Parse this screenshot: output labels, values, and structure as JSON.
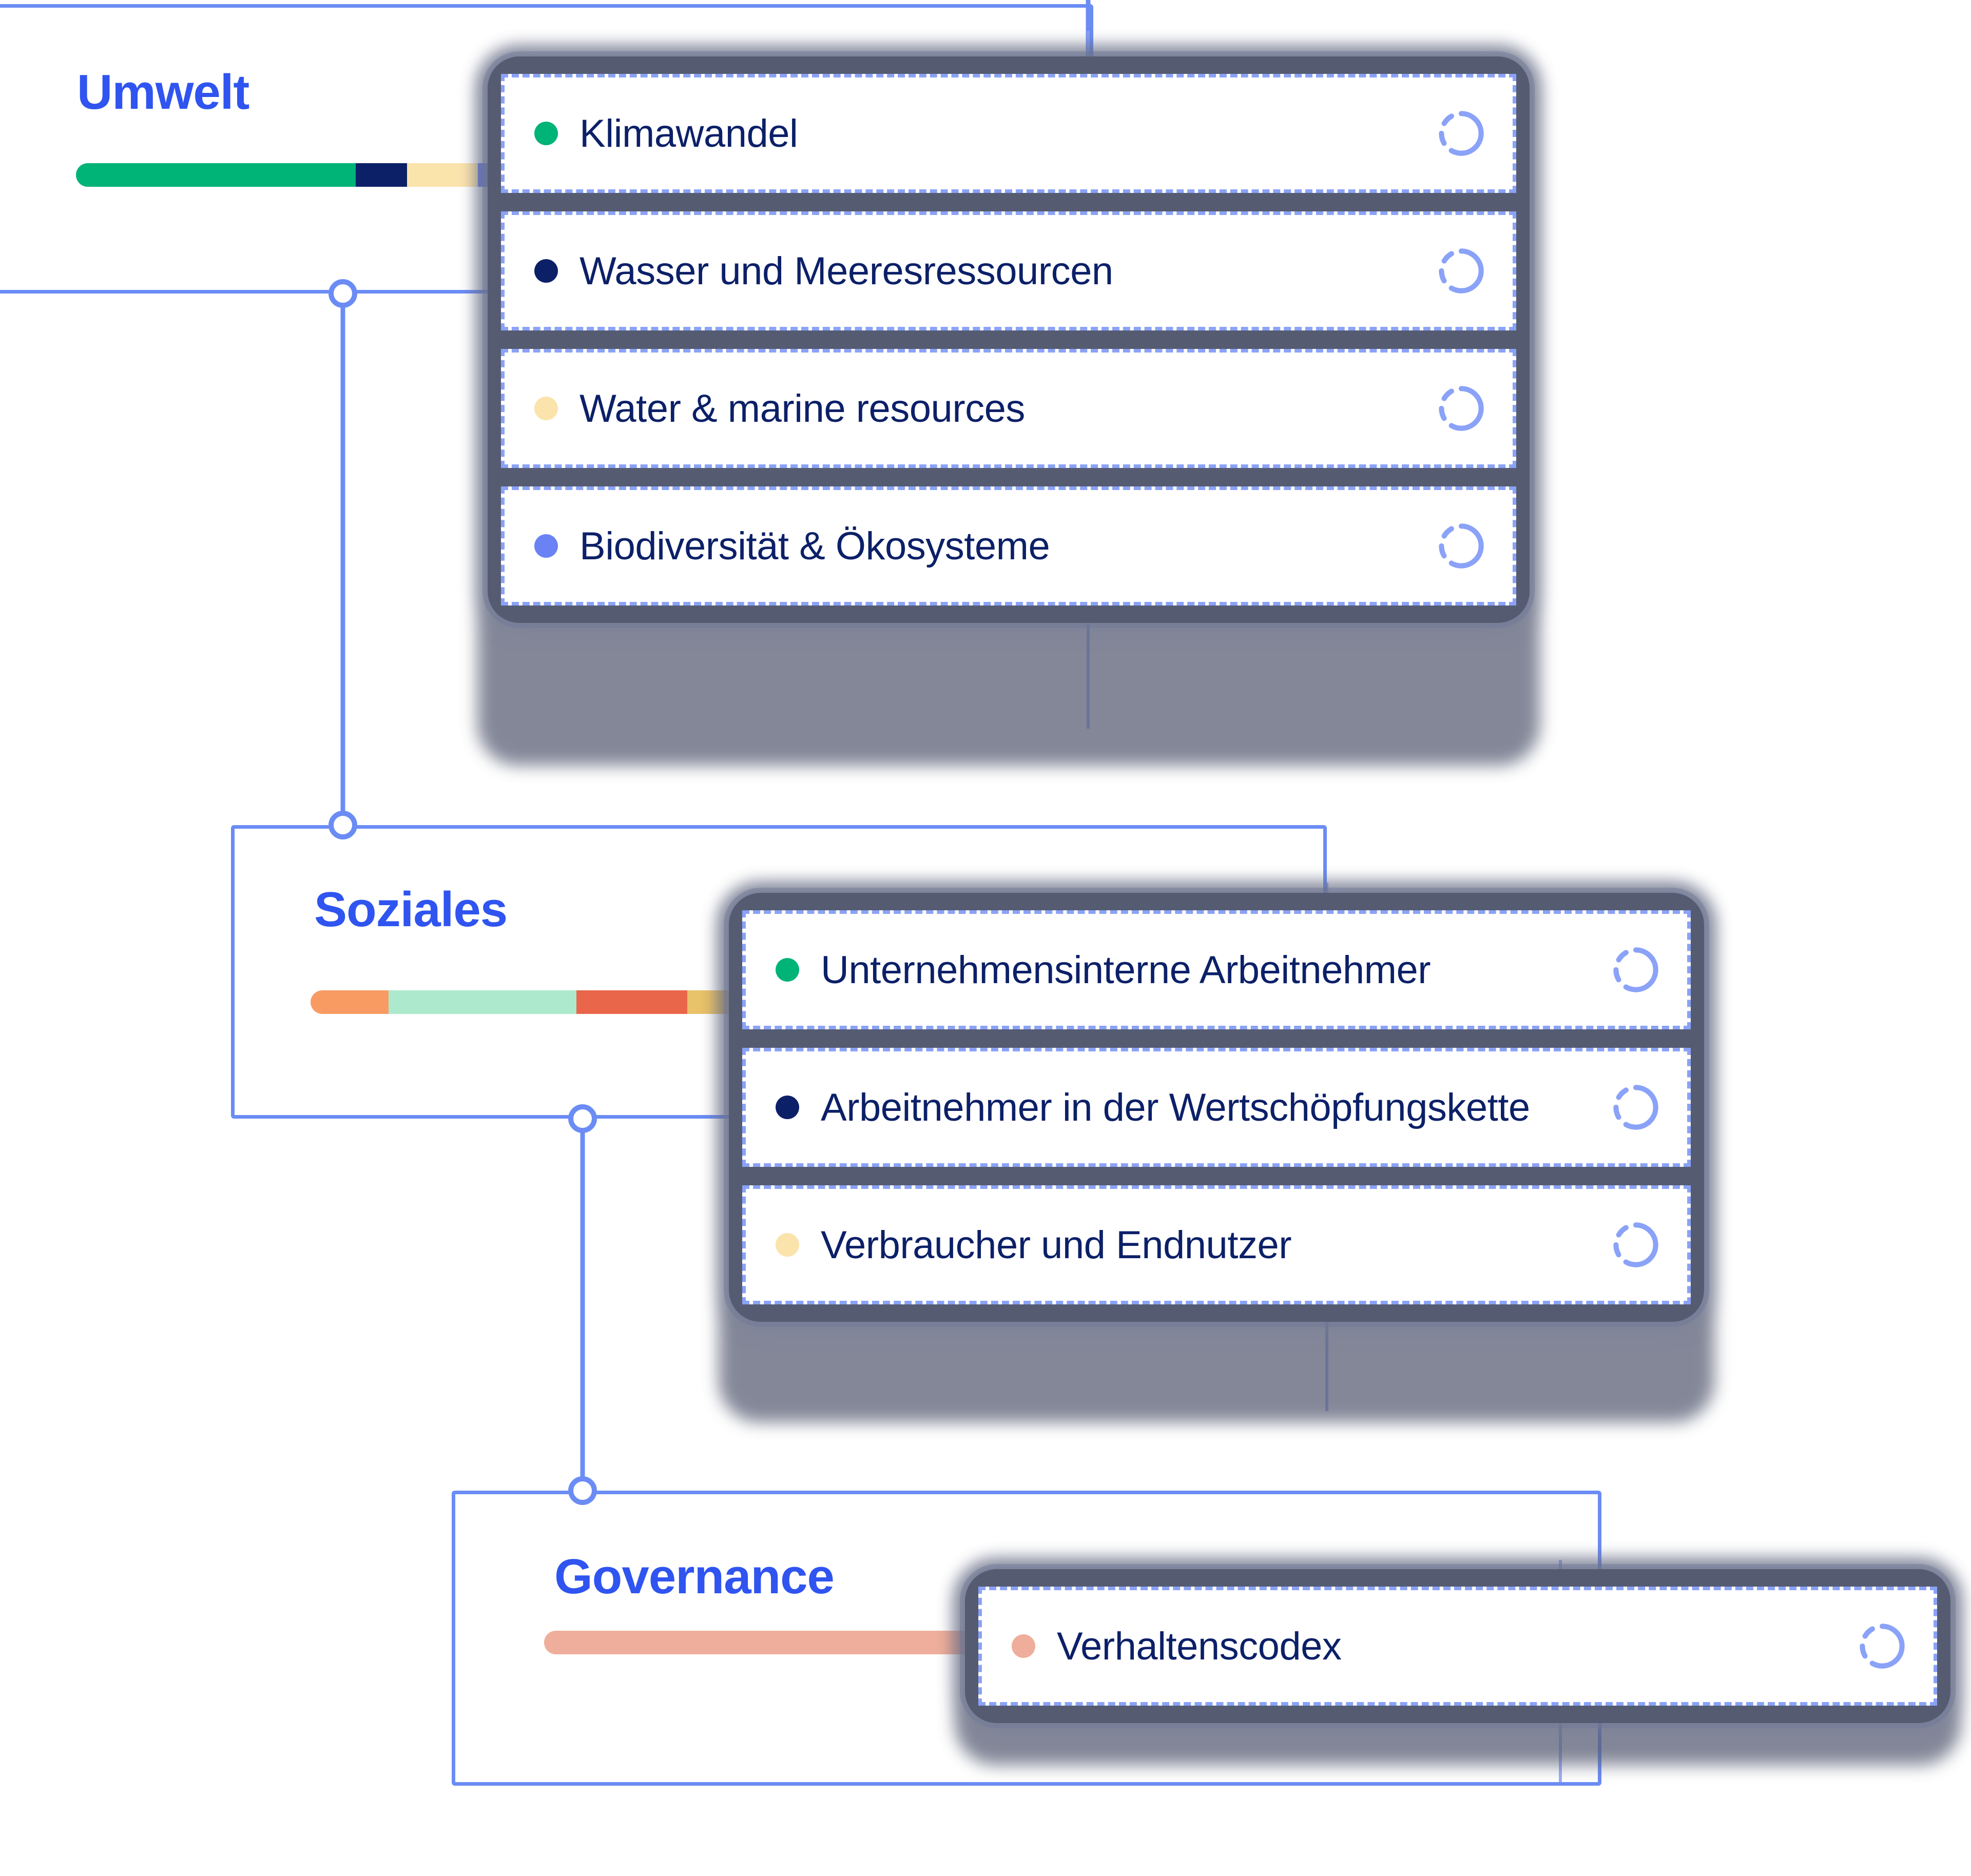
{
  "palette": {
    "accent_blue": "#2F54F0",
    "line_blue": "#6B8CF5",
    "dash_blue": "#8AA2F7",
    "card_bg": "#555C72",
    "row_bg": "#FFFFFF",
    "text_navy": "#0C2068",
    "green": "#00B377",
    "navy": "#0C2068",
    "light_yellow": "#FBE3AC",
    "periwinkle": "#6B82F5",
    "orange": "#F89B63",
    "mint": "#ADE9CC",
    "coral": "#E9664A",
    "gold": "#E9C269",
    "salmon": "#EFAE9B"
  },
  "sections": [
    {
      "id": "umwelt",
      "title": "Umwelt",
      "bar": [
        {
          "color": "#00B377",
          "weight": 228
        },
        {
          "color": "#0C2068",
          "weight": 42
        },
        {
          "color": "#FBE3AC",
          "weight": 58
        },
        {
          "color": "#6B82F5",
          "weight": 30
        }
      ],
      "rows": [
        {
          "label": "Klimawandel",
          "dot": "#00B377",
          "icon": "loading-spinner-icon"
        },
        {
          "label": "Wasser und Meeresressourcen",
          "dot": "#0C2068",
          "icon": "loading-spinner-icon"
        },
        {
          "label": "Water & marine resources",
          "dot": "#FBE3AC",
          "icon": "loading-spinner-icon"
        },
        {
          "label": "Biodiversität & Ökosysteme",
          "dot": "#6B82F5",
          "icon": "loading-spinner-icon"
        }
      ]
    },
    {
      "id": "soziales",
      "title": "Soziales",
      "bar": [
        {
          "color": "#F89B63",
          "weight": 62
        },
        {
          "color": "#ADE9CC",
          "weight": 150
        },
        {
          "color": "#E9664A",
          "weight": 88
        },
        {
          "color": "#E9C269",
          "weight": 68
        }
      ],
      "rows": [
        {
          "label": "Unternehmensinterne Arbeitnehmer",
          "dot": "#00B377",
          "icon": "loading-spinner-icon"
        },
        {
          "label": "Arbeitnehmer in der Wertschöpfungskette",
          "dot": "#0C2068",
          "icon": "loading-spinner-icon"
        },
        {
          "label": "Verbraucher und Endnutzer",
          "dot": "#FBE3AC",
          "icon": "loading-spinner-icon"
        }
      ]
    },
    {
      "id": "governance",
      "title": "Governance",
      "bar": [
        {
          "color": "#EFAE9B",
          "weight": 100
        }
      ],
      "rows": [
        {
          "label": "Verhaltenscodex",
          "dot": "#EFAE9B",
          "icon": "loading-spinner-icon"
        }
      ]
    }
  ]
}
